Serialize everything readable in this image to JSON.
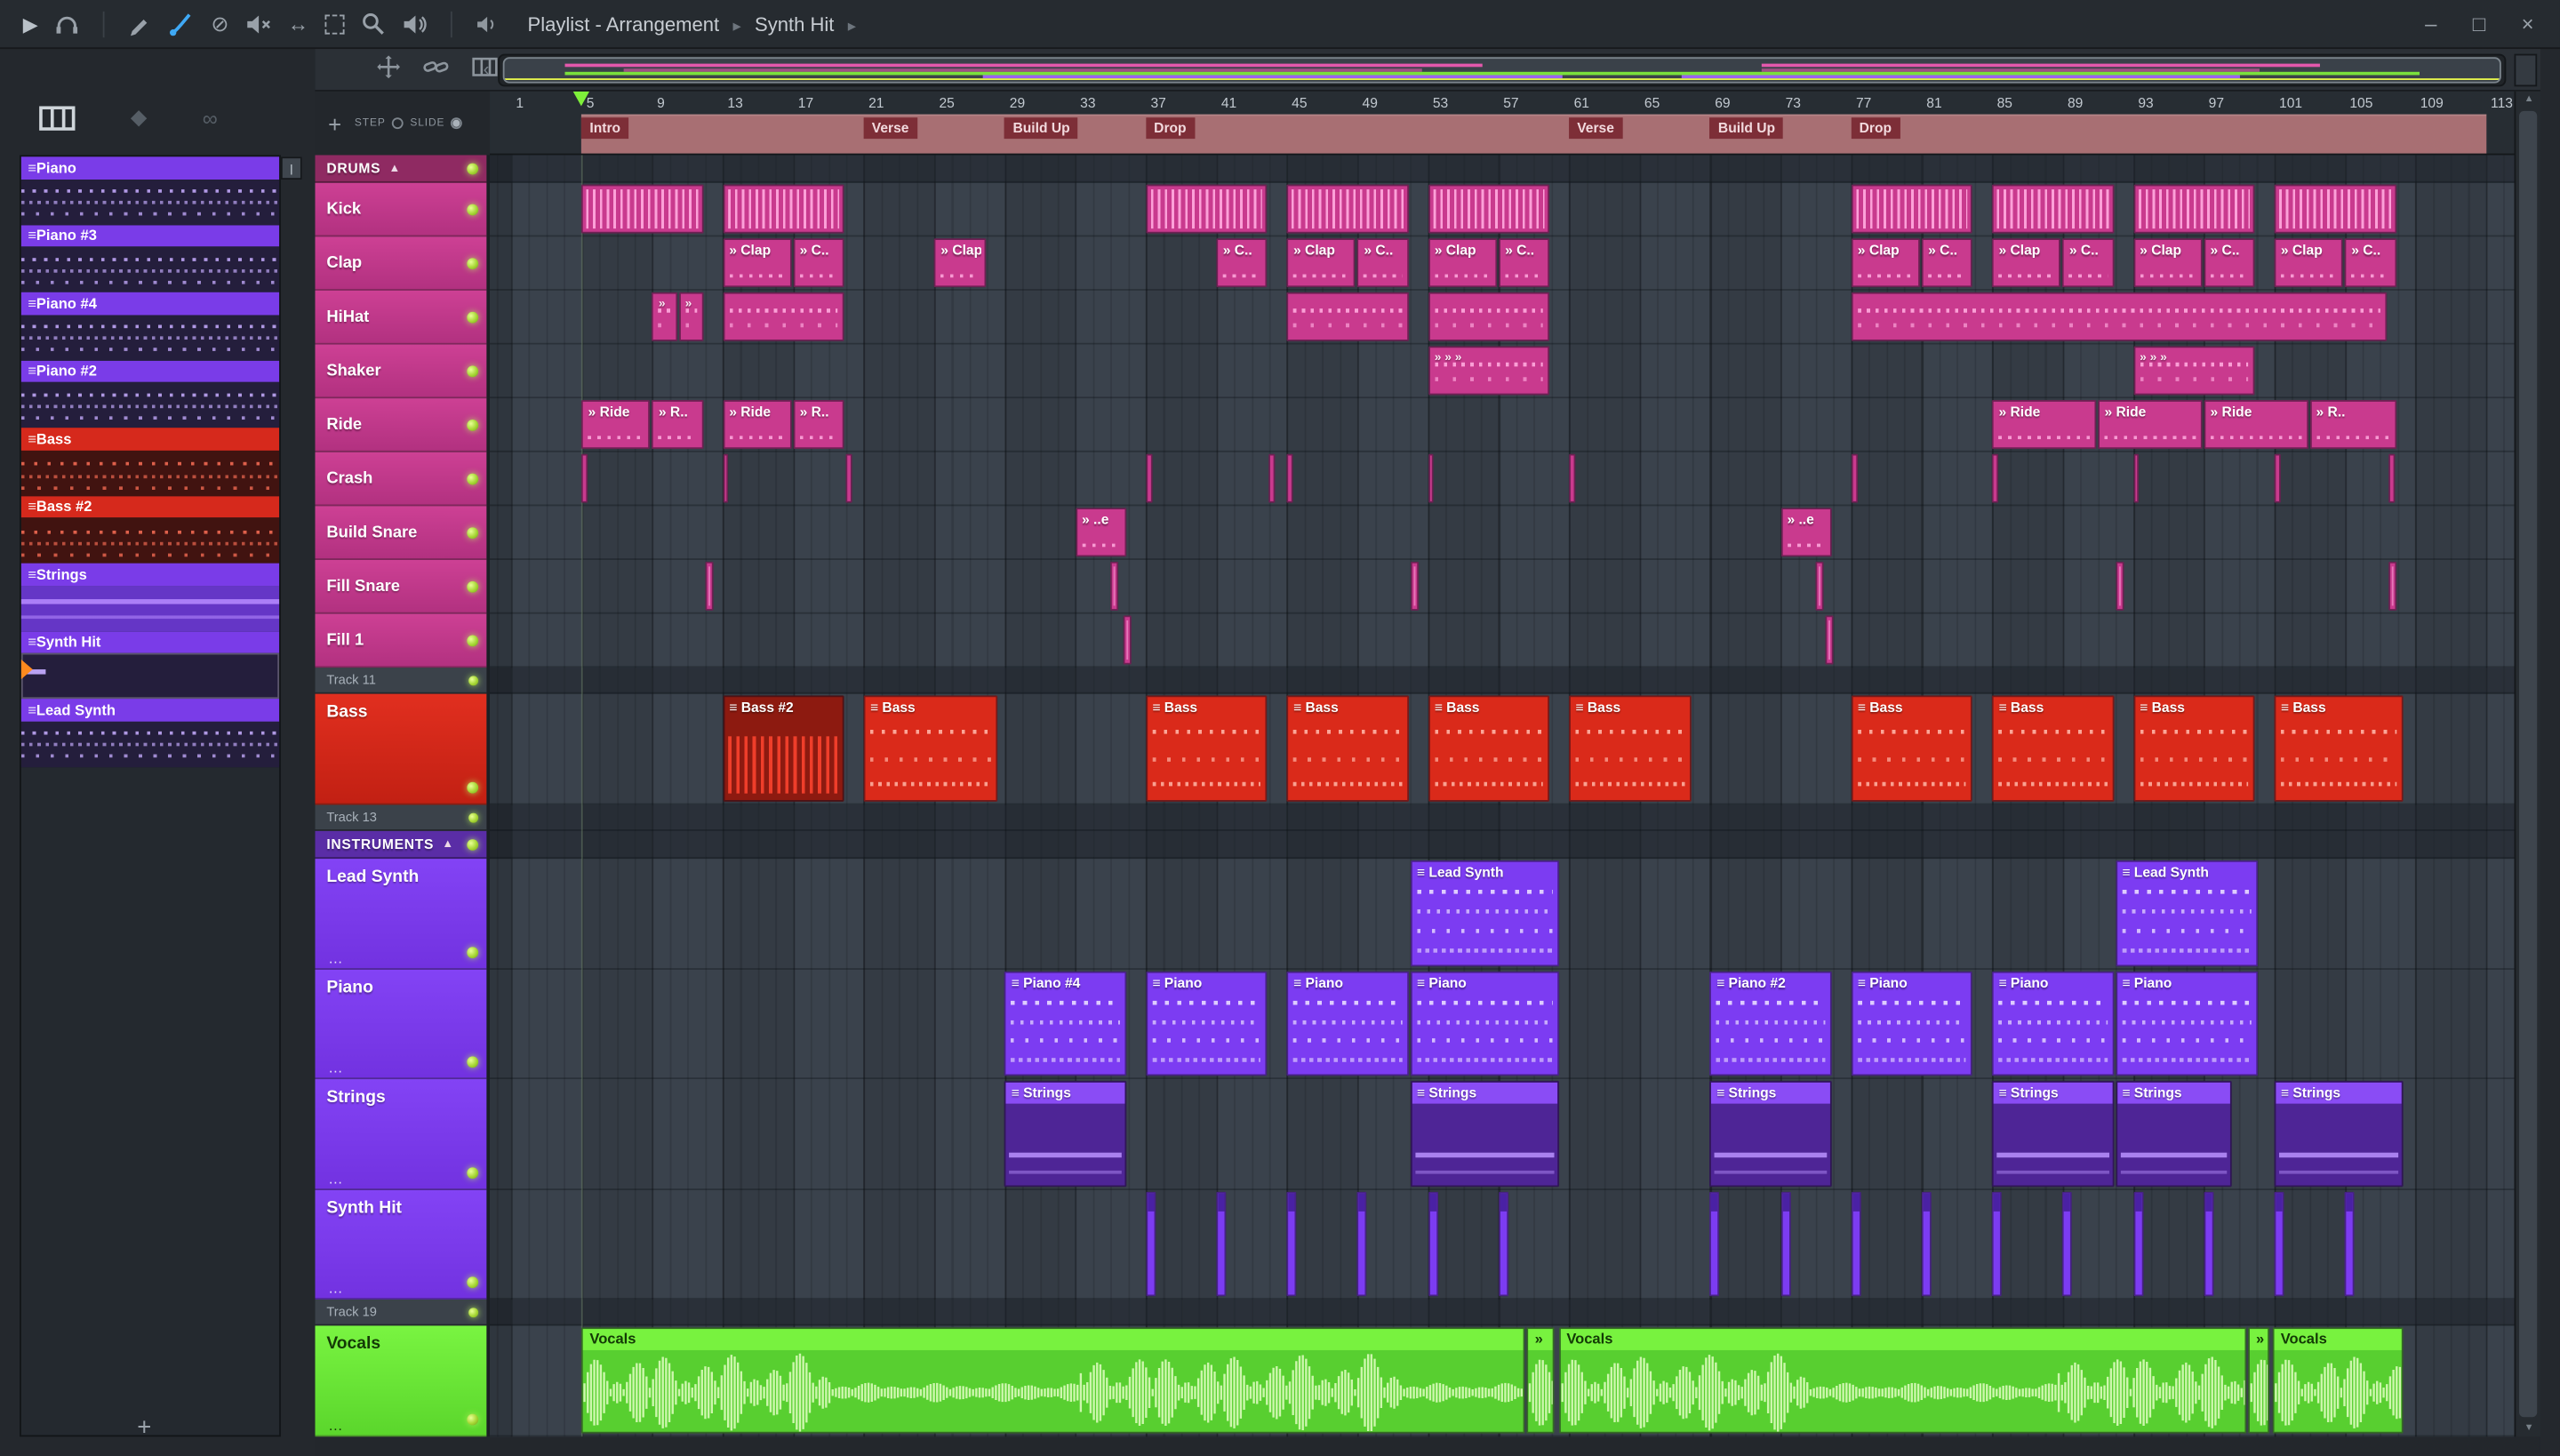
{
  "titlebar": {
    "title": "Playlist - Arrangement",
    "crumb": "Synth Hit",
    "separator": "▸",
    "window_buttons": {
      "minimize": "–",
      "maximize": "□",
      "close": "×"
    }
  },
  "toolbar_icons": [
    "play",
    "headphones",
    "draw-pencil",
    "paint-brush",
    "delete-slash",
    "mute-speaker",
    "slip-arrows",
    "select-frame",
    "zoom-magnifier",
    "playback-speaker"
  ],
  "side_icons": [
    "piano-roll",
    "diamond",
    "link"
  ],
  "patterns": [
    {
      "name": "Piano",
      "color": "#7a3ce8",
      "style": "notes",
      "selected": false
    },
    {
      "name": "Piano #3",
      "color": "#7a3ce8",
      "style": "notes",
      "selected": false
    },
    {
      "name": "Piano #4",
      "color": "#7a3ce8",
      "style": "notes",
      "selected": false
    },
    {
      "name": "Piano #2",
      "color": "#7a3ce8",
      "style": "notes",
      "selected": false
    },
    {
      "name": "Bass",
      "color": "#d6291c",
      "style": "bass",
      "selected": false
    },
    {
      "name": "Bass #2",
      "color": "#d6291c",
      "style": "bass",
      "selected": false
    },
    {
      "name": "Strings",
      "color": "#7a3ce8",
      "style": "strings",
      "selected": false
    },
    {
      "name": "Synth Hit",
      "color": "#7a3ce8",
      "style": "hit",
      "selected": true
    },
    {
      "name": "Lead Synth",
      "color": "#7a3ce8",
      "style": "notes",
      "selected": false
    }
  ],
  "playlist": {
    "step_label": "STEP",
    "slide_label": "SLIDE",
    "tracks": [
      {
        "label": "DRUMS",
        "kind": "group",
        "group": "drums"
      },
      {
        "label": "Kick",
        "kind": "drum"
      },
      {
        "label": "Clap",
        "kind": "drum"
      },
      {
        "label": "HiHat",
        "kind": "drum"
      },
      {
        "label": "Shaker",
        "kind": "drum"
      },
      {
        "label": "Ride",
        "kind": "drum"
      },
      {
        "label": "Crash",
        "kind": "drum"
      },
      {
        "label": "Build Snare",
        "kind": "drum"
      },
      {
        "label": "Fill Snare",
        "kind": "drum"
      },
      {
        "label": "Fill 1",
        "kind": "drum"
      },
      {
        "label": "Track 11",
        "kind": "spacer"
      },
      {
        "label": "Bass",
        "kind": "bass"
      },
      {
        "label": "Track 13",
        "kind": "spacer"
      },
      {
        "label": "INSTRUMENTS",
        "kind": "group",
        "group": "instruments"
      },
      {
        "label": "Lead Synth",
        "kind": "inst"
      },
      {
        "label": "Piano",
        "kind": "inst"
      },
      {
        "label": "Strings",
        "kind": "inst"
      },
      {
        "label": "Synth Hit",
        "kind": "inst"
      },
      {
        "label": "Track 19",
        "kind": "spacer"
      },
      {
        "label": "Vocals",
        "kind": "vocal"
      }
    ],
    "ruler": {
      "numbers": [
        1,
        5,
        9,
        13,
        17,
        21,
        25,
        29,
        33,
        37,
        41,
        45,
        49,
        53,
        57,
        61,
        65,
        69,
        73,
        77,
        81,
        85,
        89,
        93,
        97,
        101,
        105,
        109,
        113
      ],
      "sections": [
        {
          "label": "Intro",
          "bar": 5
        },
        {
          "label": "Verse",
          "bar": 21
        },
        {
          "label": "Build Up",
          "bar": 29
        },
        {
          "label": "Drop",
          "bar": 37
        },
        {
          "label": "Verse",
          "bar": 61
        },
        {
          "label": "Build Up",
          "bar": 69
        },
        {
          "label": "Drop",
          "bar": 77
        }
      ],
      "song_start_bar": 5,
      "song_end_bar": 113
    },
    "clips": [
      {
        "t": "Kick",
        "y": "kick",
        "s": 5,
        "e": 12
      },
      {
        "t": "Kick",
        "y": "kick",
        "s": 13,
        "e": 20
      },
      {
        "t": "Kick",
        "y": "kick",
        "s": 37,
        "e": 44
      },
      {
        "t": "Kick",
        "y": "kick",
        "s": 45,
        "e": 52
      },
      {
        "t": "Kick",
        "y": "kick",
        "s": 53,
        "e": 60
      },
      {
        "t": "Kick",
        "y": "kick",
        "s": 77,
        "e": 84
      },
      {
        "t": "Kick",
        "y": "kick",
        "s": 85,
        "e": 92
      },
      {
        "t": "Kick",
        "y": "kick",
        "s": 93,
        "e": 100
      },
      {
        "t": "Kick",
        "y": "kick",
        "s": 101,
        "e": 108
      },
      {
        "t": "Clap",
        "y": "label",
        "s": 13,
        "e": 17,
        "l": "Clap"
      },
      {
        "t": "Clap",
        "y": "label",
        "s": 17,
        "e": 20,
        "l": "C.."
      },
      {
        "t": "Clap",
        "y": "label",
        "s": 25,
        "e": 28,
        "l": "Clap"
      },
      {
        "t": "Clap",
        "y": "label",
        "s": 41,
        "e": 44,
        "l": "C.."
      },
      {
        "t": "Clap",
        "y": "label",
        "s": 45,
        "e": 49,
        "l": "Clap"
      },
      {
        "t": "Clap",
        "y": "label",
        "s": 49,
        "e": 52,
        "l": "C.."
      },
      {
        "t": "Clap",
        "y": "label",
        "s": 53,
        "e": 57,
        "l": "Clap"
      },
      {
        "t": "Clap",
        "y": "label",
        "s": 57,
        "e": 60,
        "l": "C.."
      },
      {
        "t": "Clap",
        "y": "label",
        "s": 77,
        "e": 81,
        "l": "Clap"
      },
      {
        "t": "Clap",
        "y": "label",
        "s": 81,
        "e": 84,
        "l": "C.."
      },
      {
        "t": "Clap",
        "y": "label",
        "s": 85,
        "e": 89,
        "l": "Clap"
      },
      {
        "t": "Clap",
        "y": "label",
        "s": 89,
        "e": 92,
        "l": "C.."
      },
      {
        "t": "Clap",
        "y": "label",
        "s": 93,
        "e": 97,
        "l": "Clap"
      },
      {
        "t": "Clap",
        "y": "label",
        "s": 97,
        "e": 100,
        "l": "C.."
      },
      {
        "t": "Clap",
        "y": "label",
        "s": 101,
        "e": 105,
        "l": "Clap"
      },
      {
        "t": "Clap",
        "y": "label",
        "s": 105,
        "e": 108,
        "l": "C.."
      },
      {
        "t": "HiHat",
        "y": "hat",
        "s": 9,
        "e": 10.5,
        "l": "»"
      },
      {
        "t": "HiHat",
        "y": "hat",
        "s": 10.5,
        "e": 12,
        "l": "»"
      },
      {
        "t": "HiHat",
        "y": "hat",
        "s": 13,
        "e": 20
      },
      {
        "t": "HiHat",
        "y": "hat",
        "s": 45,
        "e": 52
      },
      {
        "t": "HiHat",
        "y": "hat",
        "s": 53,
        "e": 60
      },
      {
        "t": "HiHat",
        "y": "hat",
        "s": 77,
        "e": 107.5
      },
      {
        "t": "Shaker",
        "y": "hat",
        "s": 53,
        "e": 60,
        "l": "» » »"
      },
      {
        "t": "Shaker",
        "y": "hat",
        "s": 93,
        "e": 100,
        "l": "» » »"
      },
      {
        "t": "Ride",
        "y": "label",
        "s": 5,
        "e": 9,
        "l": "Ride"
      },
      {
        "t": "Ride",
        "y": "label",
        "s": 9,
        "e": 12,
        "l": "R.."
      },
      {
        "t": "Ride",
        "y": "label",
        "s": 13,
        "e": 17,
        "l": "Ride"
      },
      {
        "t": "Ride",
        "y": "label",
        "s": 17,
        "e": 20,
        "l": "R.."
      },
      {
        "t": "Ride",
        "y": "label",
        "s": 85,
        "e": 91,
        "l": "Ride"
      },
      {
        "t": "Ride",
        "y": "label",
        "s": 91,
        "e": 97,
        "l": "Ride"
      },
      {
        "t": "Ride",
        "y": "label",
        "s": 97,
        "e": 103,
        "l": "Ride"
      },
      {
        "t": "Ride",
        "y": "label",
        "s": 103,
        "e": 108,
        "l": "R.."
      },
      {
        "t": "Crash",
        "y": "thin",
        "s": 5,
        "e": 5.45
      },
      {
        "t": "Crash",
        "y": "thin",
        "s": 13,
        "e": 13.45
      },
      {
        "t": "Crash",
        "y": "thin",
        "s": 20,
        "e": 20.45
      },
      {
        "t": "Crash",
        "y": "thin",
        "s": 37,
        "e": 37.45
      },
      {
        "t": "Crash",
        "y": "thin",
        "s": 44,
        "e": 44.45
      },
      {
        "t": "Crash",
        "y": "thin",
        "s": 45,
        "e": 45.45
      },
      {
        "t": "Crash",
        "y": "thin",
        "s": 53,
        "e": 53.45
      },
      {
        "t": "Crash",
        "y": "thin",
        "s": 61,
        "e": 61.45
      },
      {
        "t": "Crash",
        "y": "thin",
        "s": 77,
        "e": 77.45
      },
      {
        "t": "Crash",
        "y": "thin",
        "s": 85,
        "e": 85.45
      },
      {
        "t": "Crash",
        "y": "thin",
        "s": 93,
        "e": 93.45
      },
      {
        "t": "Crash",
        "y": "thin",
        "s": 101,
        "e": 101.45
      },
      {
        "t": "Crash",
        "y": "thin",
        "s": 107.5,
        "e": 107.95
      },
      {
        "t": "Build Snare",
        "y": "label",
        "s": 33,
        "e": 36,
        "l": "..e"
      },
      {
        "t": "Build Snare",
        "y": "label",
        "s": 73,
        "e": 76,
        "l": "..e"
      },
      {
        "t": "Fill Snare",
        "y": "thin",
        "s": 12,
        "e": 12.55
      },
      {
        "t": "Fill Snare",
        "y": "thin",
        "s": 35,
        "e": 35.55
      },
      {
        "t": "Fill Snare",
        "y": "thin",
        "s": 52,
        "e": 52.55
      },
      {
        "t": "Fill Snare",
        "y": "thin",
        "s": 75,
        "e": 75.55
      },
      {
        "t": "Fill Snare",
        "y": "thin",
        "s": 92,
        "e": 92.55
      },
      {
        "t": "Fill Snare",
        "y": "thin",
        "s": 107.5,
        "e": 108.05
      },
      {
        "t": "Fill 1",
        "y": "thin",
        "s": 35.7,
        "e": 36.25
      },
      {
        "t": "Fill 1",
        "y": "thin",
        "s": 75.5,
        "e": 76.05
      },
      {
        "t": "Bass",
        "y": "bass2",
        "s": 13,
        "e": 20,
        "l": "Bass #2"
      },
      {
        "t": "Bass",
        "y": "bass",
        "s": 21,
        "e": 28.7,
        "l": "Bass"
      },
      {
        "t": "Bass",
        "y": "bass",
        "s": 37,
        "e": 44,
        "l": "Bass"
      },
      {
        "t": "Bass",
        "y": "bass",
        "s": 45,
        "e": 52,
        "l": "Bass"
      },
      {
        "t": "Bass",
        "y": "bass",
        "s": 53,
        "e": 60,
        "l": "Bass"
      },
      {
        "t": "Bass",
        "y": "bass",
        "s": 61,
        "e": 68,
        "l": "Bass"
      },
      {
        "t": "Bass",
        "y": "bass",
        "s": 77,
        "e": 84,
        "l": "Bass"
      },
      {
        "t": "Bass",
        "y": "bass",
        "s": 85,
        "e": 92,
        "l": "Bass"
      },
      {
        "t": "Bass",
        "y": "bass",
        "s": 93,
        "e": 100,
        "l": "Bass"
      },
      {
        "t": "Bass",
        "y": "bass",
        "s": 101,
        "e": 108.4,
        "l": "Bass"
      },
      {
        "t": "Lead Synth",
        "y": "inst",
        "s": 52,
        "e": 60.5,
        "l": "Lead Synth"
      },
      {
        "t": "Lead Synth",
        "y": "inst",
        "s": 92,
        "e": 100.2,
        "l": "Lead Synth"
      },
      {
        "t": "Piano",
        "y": "inst",
        "s": 29,
        "e": 36,
        "l": "Piano #4"
      },
      {
        "t": "Piano",
        "y": "inst",
        "s": 37,
        "e": 44,
        "l": "Piano"
      },
      {
        "t": "Piano",
        "y": "inst",
        "s": 45,
        "e": 52,
        "l": "Piano"
      },
      {
        "t": "Piano",
        "y": "inst",
        "s": 52,
        "e": 60.5,
        "l": "Piano"
      },
      {
        "t": "Piano",
        "y": "inst",
        "s": 69,
        "e": 76,
        "l": "Piano #2"
      },
      {
        "t": "Piano",
        "y": "inst",
        "s": 77,
        "e": 84,
        "l": "Piano"
      },
      {
        "t": "Piano",
        "y": "inst",
        "s": 85,
        "e": 92,
        "l": "Piano"
      },
      {
        "t": "Piano",
        "y": "inst",
        "s": 92,
        "e": 100.2,
        "l": "Piano"
      },
      {
        "t": "Strings",
        "y": "strings",
        "s": 29,
        "e": 36,
        "l": "Strings"
      },
      {
        "t": "Strings",
        "y": "strings",
        "s": 52,
        "e": 60.5,
        "l": "Strings"
      },
      {
        "t": "Strings",
        "y": "strings",
        "s": 69,
        "e": 76,
        "l": "Strings"
      },
      {
        "t": "Strings",
        "y": "strings",
        "s": 85,
        "e": 92,
        "l": "Strings"
      },
      {
        "t": "Strings",
        "y": "strings",
        "s": 92,
        "e": 98.7,
        "l": "Strings"
      },
      {
        "t": "Strings",
        "y": "strings",
        "s": 101,
        "e": 108.4,
        "l": "Strings"
      },
      {
        "t": "Synth Hit",
        "y": "hit",
        "s": 37,
        "e": 37.65
      },
      {
        "t": "Synth Hit",
        "y": "hit",
        "s": 41,
        "e": 41.65
      },
      {
        "t": "Synth Hit",
        "y": "hit",
        "s": 45,
        "e": 45.65
      },
      {
        "t": "Synth Hit",
        "y": "hit",
        "s": 49,
        "e": 49.65
      },
      {
        "t": "Synth Hit",
        "y": "hit",
        "s": 53,
        "e": 53.65
      },
      {
        "t": "Synth Hit",
        "y": "hit",
        "s": 57,
        "e": 57.65
      },
      {
        "t": "Synth Hit",
        "y": "hit",
        "s": 69,
        "e": 69.65
      },
      {
        "t": "Synth Hit",
        "y": "hit",
        "s": 73,
        "e": 73.65
      },
      {
        "t": "Synth Hit",
        "y": "hit",
        "s": 77,
        "e": 77.65
      },
      {
        "t": "Synth Hit",
        "y": "hit",
        "s": 81,
        "e": 81.65
      },
      {
        "t": "Synth Hit",
        "y": "hit",
        "s": 85,
        "e": 85.65
      },
      {
        "t": "Synth Hit",
        "y": "hit",
        "s": 89,
        "e": 89.65
      },
      {
        "t": "Synth Hit",
        "y": "hit",
        "s": 93,
        "e": 93.65
      },
      {
        "t": "Synth Hit",
        "y": "hit",
        "s": 97,
        "e": 97.65
      },
      {
        "t": "Synth Hit",
        "y": "hit",
        "s": 101,
        "e": 101.65
      },
      {
        "t": "Synth Hit",
        "y": "hit",
        "s": 105,
        "e": 105.65
      },
      {
        "t": "Vocals",
        "y": "vocal",
        "s": 5,
        "e": 58.6,
        "l": "Vocals"
      },
      {
        "t": "Vocals",
        "y": "vocalcut",
        "s": 58.6,
        "e": 60.3,
        "l": "»"
      },
      {
        "t": "Vocals",
        "y": "vocal",
        "s": 60.4,
        "e": 99.5,
        "l": "Vocals"
      },
      {
        "t": "Vocals",
        "y": "vocalcut",
        "s": 99.5,
        "e": 100.8,
        "l": "»"
      },
      {
        "t": "Vocals",
        "y": "vocal",
        "s": 100.9,
        "e": 108.4,
        "l": "Vocals"
      }
    ]
  },
  "colors": {
    "drum_clip": "#c93a8e",
    "bass_clip": "#da2a1a",
    "instrument_clip": "#7c3cf2",
    "strings_clip": "#4e2596",
    "vocal_clip": "#58cf30",
    "led": "#a5d633",
    "ruler_band": "#a86f73",
    "section_tag": "#7d2e37",
    "selection_marker": "#ff8a1e"
  }
}
